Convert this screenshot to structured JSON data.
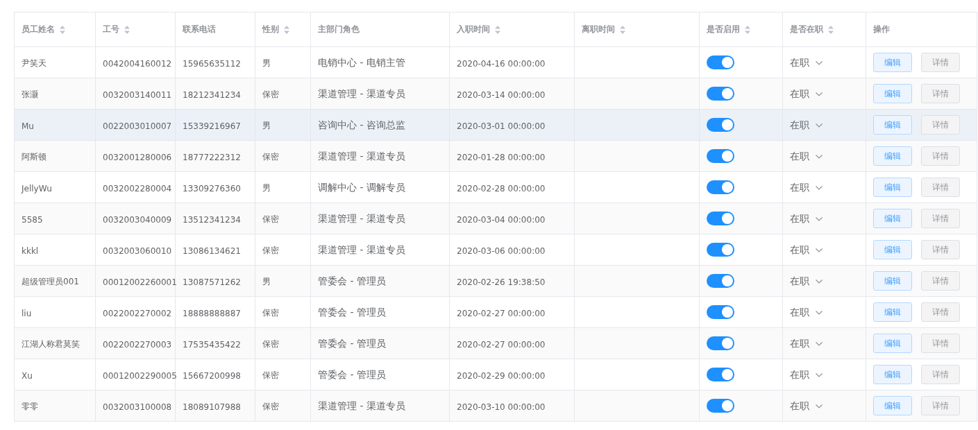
{
  "table": {
    "columns": [
      {
        "label": "员工姓名",
        "sortable": true
      },
      {
        "label": "工号",
        "sortable": true
      },
      {
        "label": "联系电话",
        "sortable": false
      },
      {
        "label": "性别",
        "sortable": true
      },
      {
        "label": "主部门角色",
        "sortable": false
      },
      {
        "label": "入职时间",
        "sortable": true
      },
      {
        "label": "离职时间",
        "sortable": true
      },
      {
        "label": "是否启用",
        "sortable": true
      },
      {
        "label": "是否在职",
        "sortable": true
      },
      {
        "label": "操作",
        "sortable": false
      }
    ],
    "rows": [
      {
        "name": "尹笑天",
        "id": "0042004160012",
        "phone": "15965635112",
        "gender": "男",
        "role": "电销中心 - 电销主管",
        "join_time": "2020-04-16 00:00:00",
        "enabled": true,
        "status": "在职",
        "highlighted": false,
        "actions": [
          "编辑",
          "详情"
        ]
      },
      {
        "name": "张灏",
        "id": "0032003140011",
        "phone": "18212341234",
        "gender": "保密",
        "role": "渠道管理 - 渠道专员",
        "join_time": "2020-03-14 00:00:00",
        "enabled": true,
        "status": "在职",
        "highlighted": false,
        "actions": [
          "编辑",
          "详情"
        ]
      },
      {
        "name": "Mu",
        "id": "0022003010007",
        "phone": "15339216967",
        "gender": "男",
        "role": "咨询中心 - 咨询总监",
        "join_time": "2020-03-01 00:00:00",
        "enabled": true,
        "status": "在职",
        "highlighted": true,
        "actions": [
          "编辑",
          "详情"
        ]
      },
      {
        "name": "阿斯顿",
        "id": "0032001280006",
        "phone": "18777222312",
        "gender": "保密",
        "role": "渠道管理 - 渠道专员",
        "join_time": "2020-01-28 00:00:00",
        "enabled": true,
        "status": "在职",
        "highlighted": false,
        "actions": [
          "编辑",
          "详情"
        ]
      },
      {
        "name": "JellyWu",
        "id": "0032002280004",
        "phone": "13309276360",
        "gender": "男",
        "role": "调解中心 - 调解专员",
        "join_time": "2020-02-28 00:00:00",
        "enabled": true,
        "status": "在职",
        "highlighted": false,
        "actions": [
          "编辑",
          "详情"
        ]
      },
      {
        "name": "5585",
        "id": "0032003040009",
        "phone": "13512341234",
        "gender": "保密",
        "role": "渠道管理 - 渠道专员",
        "join_time": "2020-03-04 00:00:00",
        "enabled": true,
        "status": "在职",
        "highlighted": false,
        "actions": [
          "编辑",
          "详情"
        ]
      },
      {
        "name": "kkkl",
        "id": "0032003060010",
        "phone": "13086134621",
        "gender": "保密",
        "role": "渠道管理 - 渠道专员",
        "join_time": "2020-03-06 00:00:00",
        "enabled": true,
        "status": "在职",
        "highlighted": false,
        "actions": [
          "编辑",
          "详情"
        ]
      },
      {
        "name": "超级管理员001",
        "id": "00012002260001",
        "phone": "13087571262",
        "gender": "男",
        "role": "管委会 - 管理员",
        "join_time": "2020-02-26 19:38:50",
        "enabled": true,
        "status": "在职",
        "highlighted": false,
        "actions": [
          "编辑",
          "详情"
        ]
      },
      {
        "name": "liu",
        "id": "0022002270002",
        "phone": "18888888887",
        "gender": "保密",
        "role": "管委会 - 管理员",
        "join_time": "2020-02-27 00:00:00",
        "enabled": true,
        "status": "在职",
        "highlighted": false,
        "actions": [
          "编辑",
          "详情"
        ]
      },
      {
        "name": "江湖人称君莫笑",
        "id": "0022002270003",
        "phone": "17535435422",
        "gender": "保密",
        "role": "管委会 - 管理员",
        "join_time": "2020-02-27 00:00:00",
        "enabled": true,
        "status": "在职",
        "highlighted": false,
        "actions": [
          "编辑",
          "详情"
        ]
      },
      {
        "name": "Xu",
        "id": "00012002290005",
        "phone": "15667200998",
        "gender": "保密",
        "role": "管委会 - 管理员",
        "join_time": "2020-02-29 00:00:00",
        "enabled": true,
        "status": "在职",
        "highlighted": false,
        "actions": [
          "编辑",
          "详情"
        ]
      },
      {
        "name": "零零",
        "id": "0032003100008",
        "phone": "18089107988",
        "gender": "保密",
        "role": "渠道管理 - 渠道专员",
        "join_time": "2020-03-10 00:00:00",
        "enabled": true,
        "status": "在职",
        "highlighted": false,
        "actions": [
          "编辑",
          "详情"
        ]
      }
    ]
  }
}
